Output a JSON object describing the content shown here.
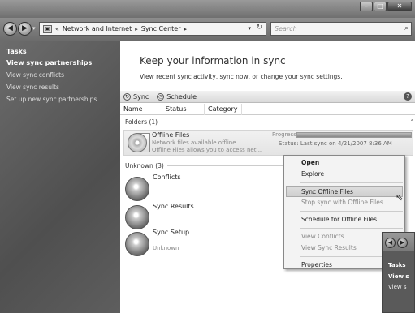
{
  "window": {
    "minimize": "–",
    "maximize": "□",
    "close": "✕"
  },
  "address": {
    "back_glyph": "◀",
    "forward_glyph": "▶",
    "overflow": "«",
    "crumbs": [
      "Network and Internet",
      "Sync Center"
    ],
    "separator": "▸",
    "dropdown_glyph": "▾",
    "refresh_glyph": "↻",
    "search_placeholder": "Search",
    "search_glyph": "⌕"
  },
  "sidebar": {
    "title": "Tasks",
    "items": [
      {
        "label": "View sync partnerships",
        "bold": true
      },
      {
        "label": "View sync conflicts"
      },
      {
        "label": "View sync results"
      },
      {
        "label": "Set up new sync partnerships"
      }
    ]
  },
  "main": {
    "heading": "Keep your information in sync",
    "subtext": "View recent sync activity, sync now, or change your sync settings.",
    "toolbar": {
      "sync": "Sync",
      "schedule": "Schedule",
      "help": "?"
    },
    "columns": [
      "Name",
      "Status",
      "Category"
    ],
    "group_folders": "Folders (1)",
    "group_unknown": "Unknown (3)",
    "offline": {
      "title": "Offline Files",
      "line1": "Network files available offline",
      "line2": "Offline Files allows you to access net...",
      "progress_label": "Progress:",
      "progress_fraction": 1.0,
      "status": "Status: Last sync on 4/21/2007 8:36 AM"
    },
    "conflicts": "Conflicts",
    "sync_results": "Sync Results",
    "sync_setup": "Sync Setup",
    "sync_setup_sub": "Unknown"
  },
  "context_menu": {
    "items": [
      "Open",
      "Explore",
      "Sync Offline Files",
      "Stop sync with Offline Files",
      "Schedule for Offline Files",
      "View Conflicts",
      "View Sync Results",
      "Properties"
    ]
  },
  "win2": {
    "tasks": "Tasks",
    "view": "View s",
    "viewsub": "View s"
  }
}
